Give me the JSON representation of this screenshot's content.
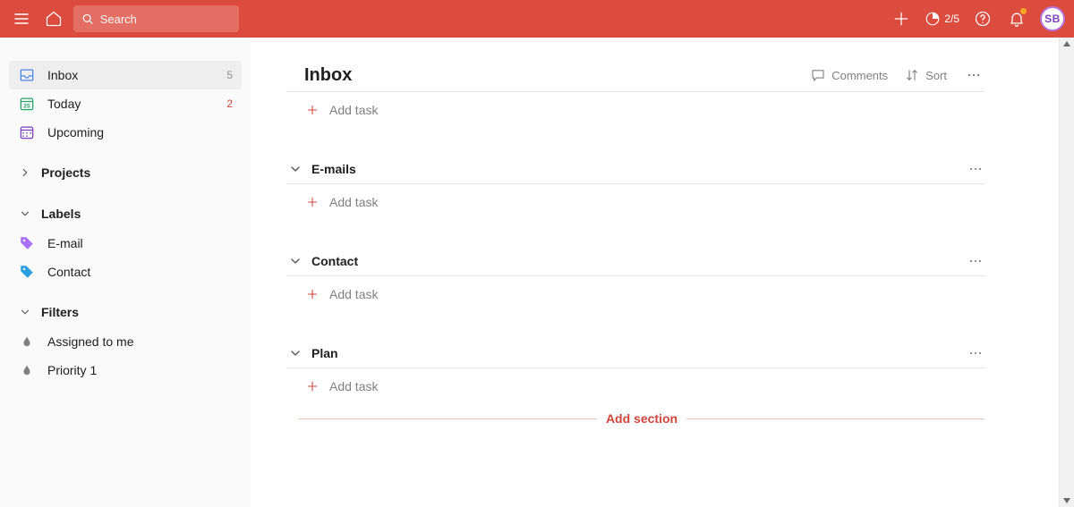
{
  "header": {
    "search_placeholder": "Search",
    "productivity": "2/5",
    "avatar_initials": "SB"
  },
  "sidebar": {
    "nav": [
      {
        "id": "inbox",
        "label": "Inbox",
        "count": "5",
        "count_color": "gray",
        "active": true
      },
      {
        "id": "today",
        "label": "Today",
        "count": "2",
        "count_color": "red",
        "active": false
      },
      {
        "id": "upcoming",
        "label": "Upcoming",
        "count": "",
        "count_color": "",
        "active": false
      }
    ],
    "projects_label": "Projects",
    "labels_label": "Labels",
    "labels": [
      {
        "id": "email",
        "label": "E-mail",
        "color": "#a970ff"
      },
      {
        "id": "contact",
        "label": "Contact",
        "color": "#299fe0"
      }
    ],
    "filters_label": "Filters",
    "filters": [
      {
        "id": "assigned",
        "label": "Assigned to me"
      },
      {
        "id": "p1",
        "label": "Priority 1"
      }
    ]
  },
  "main": {
    "title": "Inbox",
    "comments_label": "Comments",
    "sort_label": "Sort",
    "add_task_label": "Add task",
    "add_section_label": "Add section",
    "sections": [
      {
        "id": "emails",
        "title": "E-mails"
      },
      {
        "id": "contact",
        "title": "Contact"
      },
      {
        "id": "plan",
        "title": "Plan"
      }
    ]
  }
}
